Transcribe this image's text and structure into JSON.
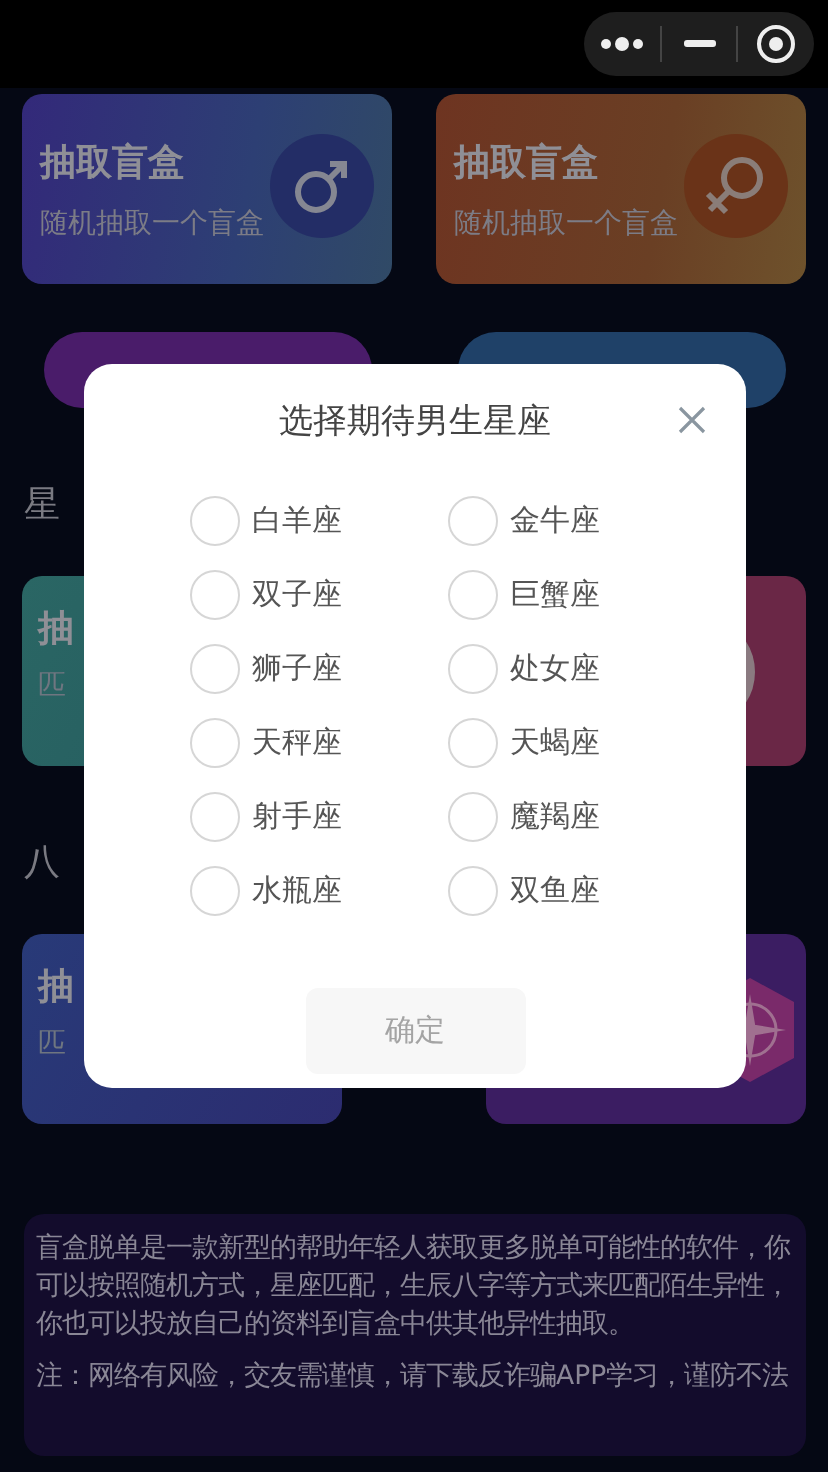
{
  "top_cards": [
    {
      "kind": "male",
      "title": "抽取盲盒",
      "subtitle": "随机抽取一个盲盒"
    },
    {
      "kind": "female",
      "title": "抽取盲盒",
      "subtitle": "随机抽取一个盲盒"
    }
  ],
  "action_buttons": [
    {
      "color": "#4a1c6a"
    },
    {
      "color": "#1f4168"
    }
  ],
  "sections": [
    {
      "heading": "星",
      "card": {
        "title": "抽",
        "subtitle": "匹"
      }
    },
    {
      "heading": "八",
      "card": {
        "title": "抽",
        "subtitle": "匹"
      }
    }
  ],
  "dialog": {
    "title": "选择期待男生星座",
    "options": [
      {
        "label": "白羊座",
        "selected": false
      },
      {
        "label": "金牛座",
        "selected": false
      },
      {
        "label": "双子座",
        "selected": false
      },
      {
        "label": "巨蟹座",
        "selected": false
      },
      {
        "label": "狮子座",
        "selected": false
      },
      {
        "label": "处女座",
        "selected": false
      },
      {
        "label": "天秤座",
        "selected": false
      },
      {
        "label": "天蝎座",
        "selected": false
      },
      {
        "label": "射手座",
        "selected": false
      },
      {
        "label": "魔羯座",
        "selected": false
      },
      {
        "label": "水瓶座",
        "selected": false
      },
      {
        "label": "双鱼座",
        "selected": false
      }
    ],
    "confirm": {
      "label": "确定",
      "disabled": true
    }
  },
  "info": {
    "paragraphs": [
      "盲盒脱单是一款新型的帮助年轻人获取更多脱单可能性的软件，你可以按照随机方式，星座匹配，生辰八字等方式来匹配陌生异性，你也可以投放自己的资料到盲盒中供其他异性抽取。",
      "注：网络有风险，交友需谨慎，请下载反诈骗APP学习，谨防不法"
    ]
  }
}
